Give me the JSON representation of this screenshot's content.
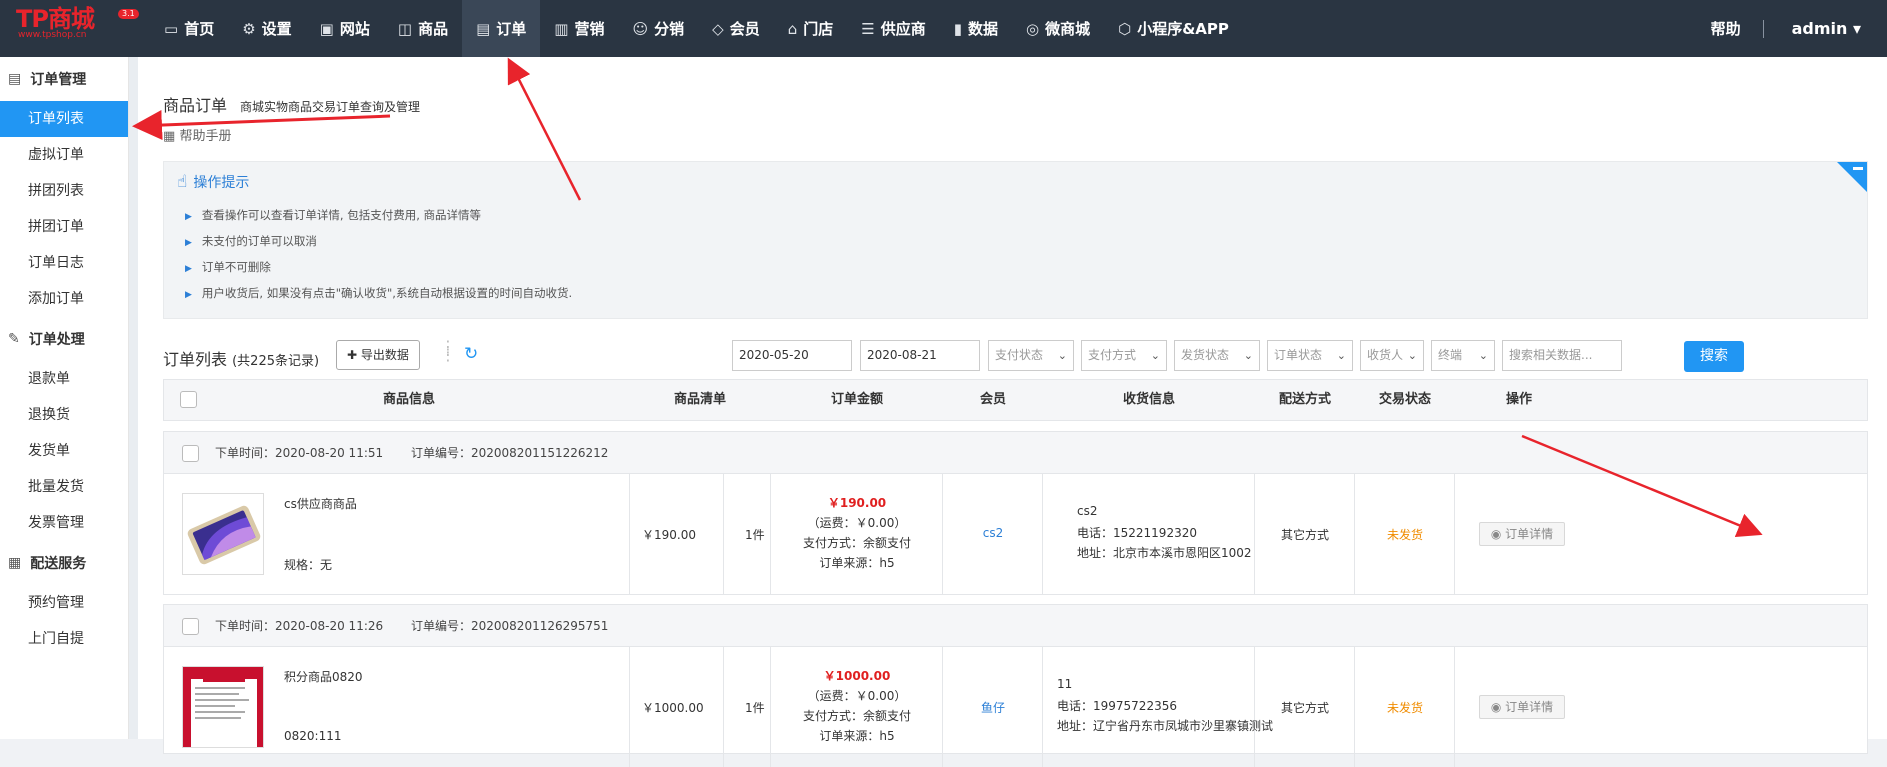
{
  "logo": {
    "text": "TP商城",
    "sub": "www.tpshop.cn",
    "version": "3.1"
  },
  "nav": [
    {
      "label": "首页",
      "icon": "monitor-icon"
    },
    {
      "label": "设置",
      "icon": "gear-icon"
    },
    {
      "label": "网站",
      "icon": "image-icon"
    },
    {
      "label": "商品",
      "icon": "bag-icon"
    },
    {
      "label": "订单",
      "icon": "document-icon"
    },
    {
      "label": "营销",
      "icon": "chart-bars-icon"
    },
    {
      "label": "分销",
      "icon": "users-icon"
    },
    {
      "label": "会员",
      "icon": "diamond-icon"
    },
    {
      "label": "门店",
      "icon": "store-icon"
    },
    {
      "label": "供应商",
      "icon": "list-icon"
    },
    {
      "label": "数据",
      "icon": "bar-chart-icon"
    },
    {
      "label": "微商城",
      "icon": "wechat-icon"
    },
    {
      "label": "小程序&APP",
      "icon": "cube-icon"
    }
  ],
  "header_right": {
    "help": "帮助",
    "user": "admin"
  },
  "sidebar": {
    "groups": [
      {
        "title": "订单管理",
        "items": [
          "订单列表",
          "虚拟订单",
          "拼团列表",
          "拼团订单",
          "订单日志",
          "添加订单"
        ]
      },
      {
        "title": "订单处理",
        "items": [
          "退款单",
          "退换货",
          "发货单",
          "批量发货",
          "发票管理"
        ]
      },
      {
        "title": "配送服务",
        "items": [
          "预约管理",
          "上门自提"
        ]
      }
    ]
  },
  "page": {
    "title": "商品订单",
    "subtitle": "商城实物商品交易订单查询及管理",
    "manual": "帮助手册"
  },
  "tips": {
    "title": "操作提示",
    "items": [
      "查看操作可以查看订单详情, 包括支付费用, 商品详情等",
      "未支付的订单可以取消",
      "订单不可删除",
      "用户收货后, 如果没有点击\"确认收货\",系统自动根据设置的时间自动收货."
    ]
  },
  "list": {
    "title": "订单列表",
    "count": "(共225条记录)",
    "export": "导出数据"
  },
  "filters": {
    "date_start": "2020-05-20",
    "date_end": "2020-08-21",
    "pay_status": "支付状态",
    "pay_method": "支付方式",
    "ship_status": "发货状态",
    "order_status": "订单状态",
    "receiver": "收货人",
    "terminal": "终端",
    "search_placeholder": "搜索相关数据...",
    "search_button": "搜索"
  },
  "columns": [
    "商品信息",
    "商品清单",
    "订单金额",
    "会员",
    "收货信息",
    "配送方式",
    "交易状态",
    "操作"
  ],
  "orders": [
    {
      "time": "下单时间：2020-08-20 11:51",
      "order_no": "订单编号：202008201151226212",
      "product": "cs供应商商品",
      "spec": "规格：无",
      "price": "￥190.00",
      "qty": "1件",
      "total": "￥190.00",
      "shipping_fee": "（运费：￥0.00）",
      "pay_method": "支付方式：余额支付",
      "source": "订单来源：h5",
      "member": "cs2",
      "recv_name": "cs2",
      "recv_phone": "电话：15221192320",
      "recv_addr": "地址：北京市本溪市恩阳区1002",
      "delivery": "其它方式",
      "status": "未发货",
      "action": "订单详情"
    },
    {
      "time": "下单时间：2020-08-20 11:26",
      "order_no": "订单编号：202008201126295751",
      "product": "积分商品0820",
      "spec": "0820:111",
      "price": "￥1000.00",
      "qty": "1件",
      "total": "￥1000.00",
      "shipping_fee": "（运费：￥0.00）",
      "pay_method": "支付方式：余额支付",
      "source": "订单来源：h5",
      "member": "鱼仔",
      "recv_name": "11",
      "recv_phone": "电话：19975722356",
      "recv_addr": "地址：辽宁省丹东市凤城市沙里寨镇测试",
      "delivery": "其它方式",
      "status": "未发货",
      "action": "订单详情"
    }
  ]
}
